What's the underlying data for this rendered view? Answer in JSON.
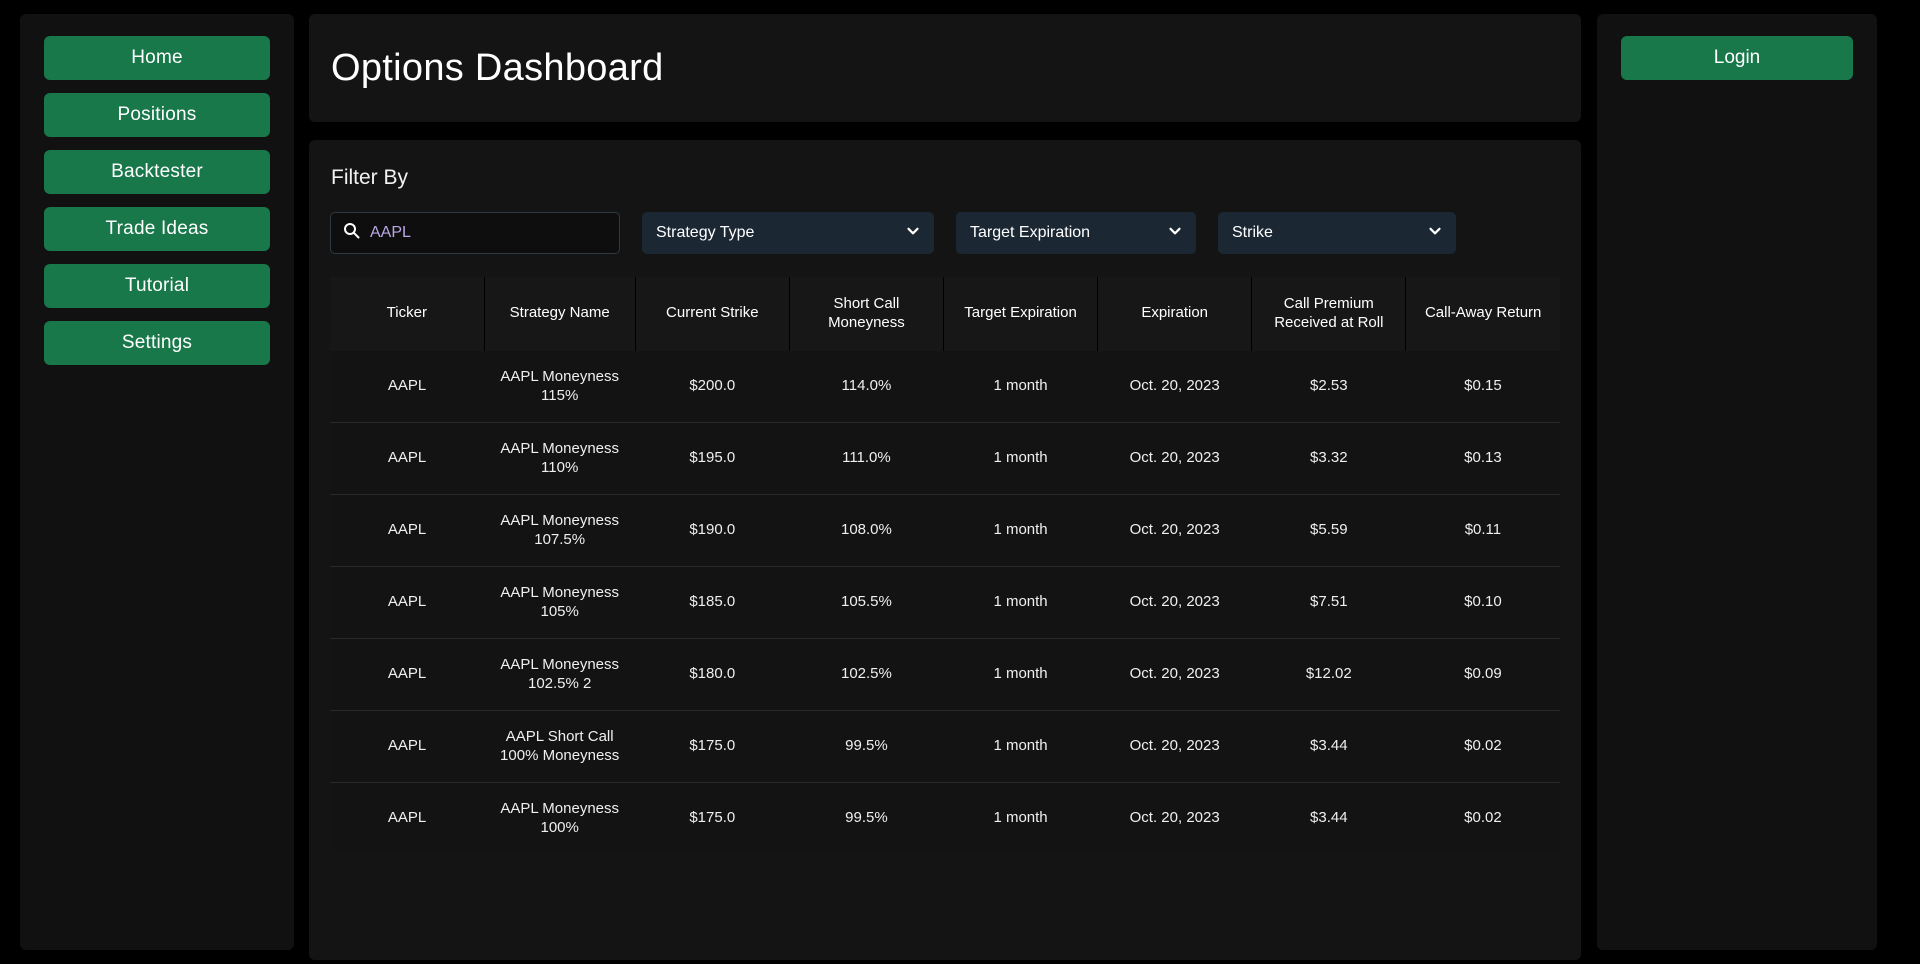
{
  "theme": {
    "page_background": "#000000",
    "panel_background": "#111111",
    "card_background": "#141414",
    "accent_green": "#18784a",
    "select_background": "#1b2733",
    "input_text_color": "#b9a7e8",
    "text_primary": "#ffffff"
  },
  "sidebar": {
    "items": [
      {
        "label": "Home",
        "icon": "home-nav"
      },
      {
        "label": "Positions",
        "icon": "positions-nav"
      },
      {
        "label": "Backtester",
        "icon": "backtester-nav"
      },
      {
        "label": "Trade Ideas",
        "icon": "trade-ideas-nav"
      },
      {
        "label": "Tutorial",
        "icon": "tutorial-nav"
      },
      {
        "label": "Settings",
        "icon": "settings-nav"
      }
    ]
  },
  "header": {
    "title": "Options Dashboard"
  },
  "filters": {
    "label": "Filter By",
    "search": {
      "icon": "search-icon",
      "value": "AAPL",
      "placeholder": "Search"
    },
    "selects": [
      {
        "label": "Strategy Type",
        "icon": "chevron-down-icon"
      },
      {
        "label": "Target Expiration",
        "icon": "chevron-down-icon"
      },
      {
        "label": "Strike",
        "icon": "chevron-down-icon"
      }
    ]
  },
  "table": {
    "columns": [
      "Ticker",
      "Strategy Name",
      "Current Strike",
      "Short Call Moneyness",
      "Target Expiration",
      "Expiration",
      "Call Premium Received at Roll",
      "Call-Away Return"
    ],
    "rows": [
      {
        "ticker": "AAPL",
        "strategy_name": "AAPL Moneyness 115%",
        "current_strike": "$200.0",
        "short_call_moneyness": "114.0%",
        "target_expiration": "1 month",
        "expiration": "Oct. 20, 2023",
        "call_premium_received_at_roll": "$2.53",
        "call_away_return": "$0.15"
      },
      {
        "ticker": "AAPL",
        "strategy_name": "AAPL Moneyness 110%",
        "current_strike": "$195.0",
        "short_call_moneyness": "111.0%",
        "target_expiration": "1 month",
        "expiration": "Oct. 20, 2023",
        "call_premium_received_at_roll": "$3.32",
        "call_away_return": "$0.13"
      },
      {
        "ticker": "AAPL",
        "strategy_name": "AAPL Moneyness 107.5%",
        "current_strike": "$190.0",
        "short_call_moneyness": "108.0%",
        "target_expiration": "1 month",
        "expiration": "Oct. 20, 2023",
        "call_premium_received_at_roll": "$5.59",
        "call_away_return": "$0.11"
      },
      {
        "ticker": "AAPL",
        "strategy_name": "AAPL Moneyness 105%",
        "current_strike": "$185.0",
        "short_call_moneyness": "105.5%",
        "target_expiration": "1 month",
        "expiration": "Oct. 20, 2023",
        "call_premium_received_at_roll": "$7.51",
        "call_away_return": "$0.10"
      },
      {
        "ticker": "AAPL",
        "strategy_name": "AAPL Moneyness 102.5% 2",
        "current_strike": "$180.0",
        "short_call_moneyness": "102.5%",
        "target_expiration": "1 month",
        "expiration": "Oct. 20, 2023",
        "call_premium_received_at_roll": "$12.02",
        "call_away_return": "$0.09"
      },
      {
        "ticker": "AAPL",
        "strategy_name": "AAPL Short Call 100% Moneyness",
        "current_strike": "$175.0",
        "short_call_moneyness": "99.5%",
        "target_expiration": "1 month",
        "expiration": "Oct. 20, 2023",
        "call_premium_received_at_roll": "$3.44",
        "call_away_return": "$0.02"
      },
      {
        "ticker": "AAPL",
        "strategy_name": "AAPL Moneyness 100%",
        "current_strike": "$175.0",
        "short_call_moneyness": "99.5%",
        "target_expiration": "1 month",
        "expiration": "Oct. 20, 2023",
        "call_premium_received_at_roll": "$3.44",
        "call_away_return": "$0.02"
      }
    ]
  },
  "rightbar": {
    "login_label": "Login"
  }
}
